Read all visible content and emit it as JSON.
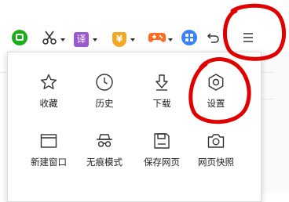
{
  "toolbar": {
    "translate_glyph": "译",
    "currency_glyph": "¥",
    "icons": [
      "wechat-icon",
      "scissors-icon",
      "translate-icon",
      "coupon-icon",
      "game-icon",
      "apps-icon",
      "undo-icon",
      "menu-icon"
    ]
  },
  "menu": {
    "items": [
      {
        "label": "收藏",
        "icon": "star-icon"
      },
      {
        "label": "历史",
        "icon": "clock-icon"
      },
      {
        "label": "下载",
        "icon": "download-icon"
      },
      {
        "label": "设置",
        "icon": "gear-icon"
      },
      {
        "label": "新建窗口",
        "icon": "new-window-icon"
      },
      {
        "label": "无痕模式",
        "icon": "incognito-icon"
      },
      {
        "label": "保存网页",
        "icon": "save-icon"
      },
      {
        "label": "网页快照",
        "icon": "camera-icon"
      }
    ]
  },
  "colors": {
    "wechat_green": "#1aad19",
    "translate_purple": "#9b59d0",
    "coupon_orange": "#f5a623",
    "game_orange": "#ff6a1f",
    "apps_blue": "#3b82f6",
    "annotation_red": "#e00000"
  }
}
